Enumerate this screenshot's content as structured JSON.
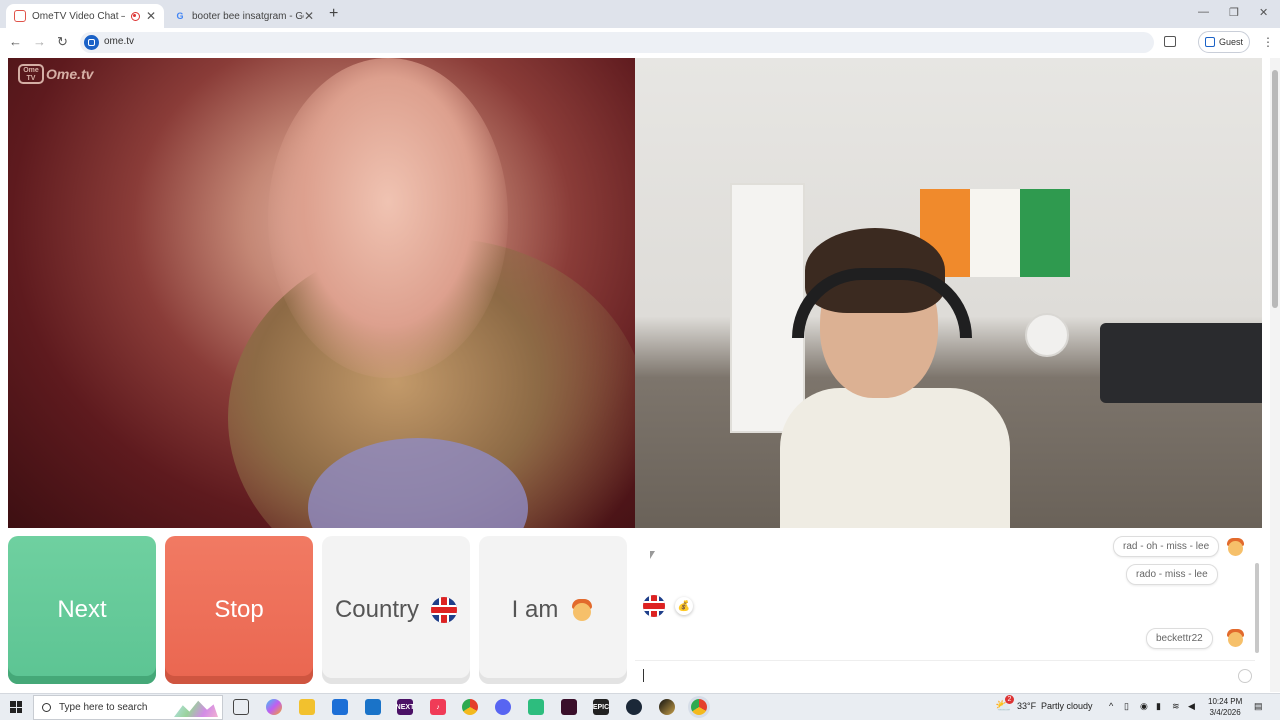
{
  "browser": {
    "tabs": [
      {
        "title": "OmeTV Video Chat — Ome",
        "active": true
      },
      {
        "title": "booter bee insatgram - Google",
        "active": false
      }
    ],
    "url": "ome.tv",
    "profile_label": "Guest",
    "new_tab_glyph": "+",
    "close_glyph": "✕"
  },
  "site": {
    "logo_badge": "Ome TV",
    "logo_text": "Ome.tv"
  },
  "controls": {
    "next_label": "Next",
    "stop_label": "Stop",
    "country_label": "Country",
    "country_flag_icon": "uk-flag-icon",
    "iam_label": "I am",
    "iam_icon": "boy-emoji-icon"
  },
  "chat": {
    "messages": [
      {
        "text": "rad - oh - miss - lee",
        "avatar": "boy-emoji-icon"
      },
      {
        "text": "rado - miss - lee"
      },
      {
        "text": "beckettr22",
        "avatar": "boy-emoji-icon"
      }
    ],
    "stranger_flag_icon": "uk-flag-icon",
    "stranger_extra_icon": "money-bag-icon",
    "input_value": ""
  },
  "taskbar": {
    "search_placeholder": "Type here to search",
    "weather_temp": "33°F",
    "weather_text": "Partly cloudy",
    "weather_badge": "2",
    "time": "10:24 PM",
    "date": "3/4/2026",
    "icons": [
      "task-view-icon",
      "copilot-icon",
      "file-explorer-icon",
      "store-icon",
      "outlook-icon",
      "next-app-icon",
      "music-icon",
      "chrome-icon",
      "discord-icon",
      "android-icon",
      "media-app-icon",
      "epic-games-icon",
      "steam-icon",
      "game-icon",
      "chrome-icon"
    ]
  },
  "colors": {
    "next": "#5cc493",
    "stop": "#ea6650",
    "neutral_button": "#f3f3f3",
    "accent_blue": "#1b62c7"
  }
}
